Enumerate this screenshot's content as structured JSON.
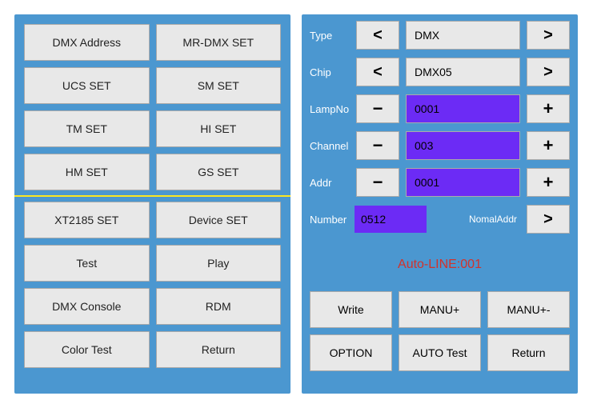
{
  "left": {
    "top": [
      "DMX Address",
      "MR-DMX SET",
      "UCS SET",
      "SM SET",
      "TM SET",
      "HI SET",
      "HM SET",
      "GS SET"
    ],
    "bottom": [
      "XT2185 SET",
      "Device SET",
      "Test",
      "Play",
      "DMX Console",
      "RDM",
      "Color Test",
      "Return"
    ]
  },
  "right": {
    "rows": {
      "type": {
        "label": "Type",
        "prev": "<",
        "value": "DMX",
        "next": ">"
      },
      "chip": {
        "label": "Chip",
        "prev": "<",
        "value": "DMX05",
        "next": ">"
      },
      "lampno": {
        "label": "LampNo",
        "minus": "−",
        "value": "0001",
        "plus": "+"
      },
      "channel": {
        "label": "Channel",
        "minus": "−",
        "value": "003",
        "plus": "+"
      },
      "addr": {
        "label": "Addr",
        "minus": "−",
        "value": "0001",
        "plus": "+"
      }
    },
    "number": {
      "label": "Number",
      "value": "0512",
      "nomal_label": "NomalAddr",
      "next": ">"
    },
    "status": "Auto-LINE:001",
    "actions": [
      "Write",
      "MANU+",
      "MANU+-",
      "OPTION",
      "AUTO Test",
      "Return"
    ]
  }
}
